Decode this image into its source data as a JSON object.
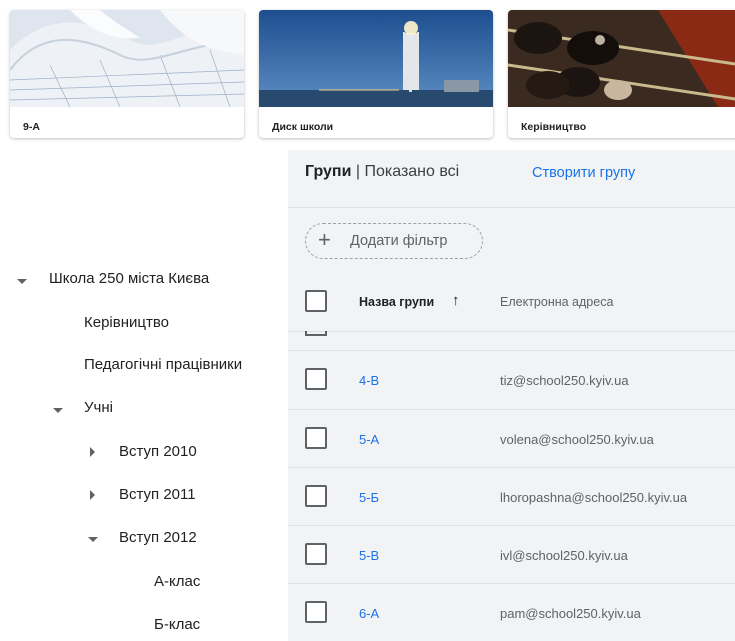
{
  "cards": [
    {
      "label": "9-А",
      "image": "blueprint-paper"
    },
    {
      "label": "Диск школи",
      "image": "lighthouse-night"
    },
    {
      "label": "Керівництво",
      "image": "abacus"
    }
  ],
  "tree": {
    "root": "Школа 250 міста Києва",
    "items": [
      "Керівництво",
      "Педагогічні працівники",
      "Учні",
      "Вступ 2010",
      "Вступ 2011",
      "Вступ 2012",
      "А-клас",
      "Б-клас"
    ]
  },
  "groups": {
    "title": "Групи",
    "divider": " | ",
    "subtitle": "Показано всі",
    "create_label": "Створити групу",
    "add_filter_label": "Додати фільтр",
    "columns": {
      "name": "Назва групи",
      "email": "Електронна адреса"
    },
    "rows": [
      {
        "name": "4-В",
        "email": "tiz@school250.kyiv.ua"
      },
      {
        "name": "5-А",
        "email": "volena@school250.kyiv.ua"
      },
      {
        "name": "5-Б",
        "email": "lhoropashna@school250.kyiv.ua"
      },
      {
        "name": "5-В",
        "email": "ivl@school250.kyiv.ua"
      },
      {
        "name": "6-А",
        "email": "pam@school250.kyiv.ua"
      }
    ]
  },
  "colors": {
    "accent": "#1a73e8",
    "panel": "#f1f3f4"
  }
}
